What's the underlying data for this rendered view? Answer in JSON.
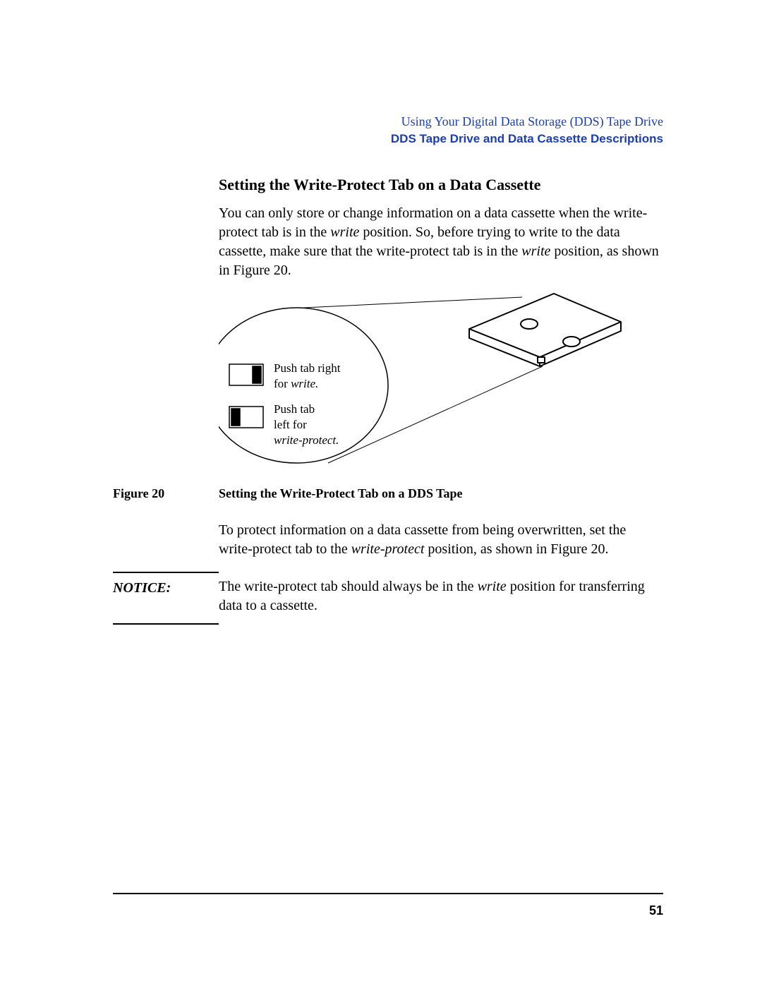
{
  "header": {
    "chapter": "Using Your Digital Data Storage (DDS) Tape Drive",
    "section": "DDS Tape Drive and Data Cassette Descriptions"
  },
  "heading": "Setting the Write-Protect Tab on a Data Cassette",
  "para1_a": "You can only store or change information on a data cassette when the write-protect tab is in the ",
  "para1_write": "write",
  "para1_b": " position. So, before trying to write to the data cassette, make sure that the write-protect tab is in the ",
  "para1_write2": "write",
  "para1_c": " position, as shown in Figure 20.",
  "figure": {
    "annot_top_a": "Push tab right",
    "annot_top_b": "for ",
    "annot_top_italic": "write.",
    "annot_bot_a": "Push tab",
    "annot_bot_b": "left for",
    "annot_bot_italic": "write-protect."
  },
  "figure_label": "Figure 20",
  "figure_caption": "Setting the Write-Protect Tab on a DDS Tape",
  "para2_a": "To protect information on a data cassette from being overwritten, set the write-protect tab to the ",
  "para2_italic": "write-protect",
  "para2_b": " position, as shown in Figure 20.",
  "notice_label": "NOTICE:",
  "notice_a": "The write-protect tab should always be in the ",
  "notice_italic": "write",
  "notice_b": " position for transferring data to a cassette.",
  "page_number": "51"
}
